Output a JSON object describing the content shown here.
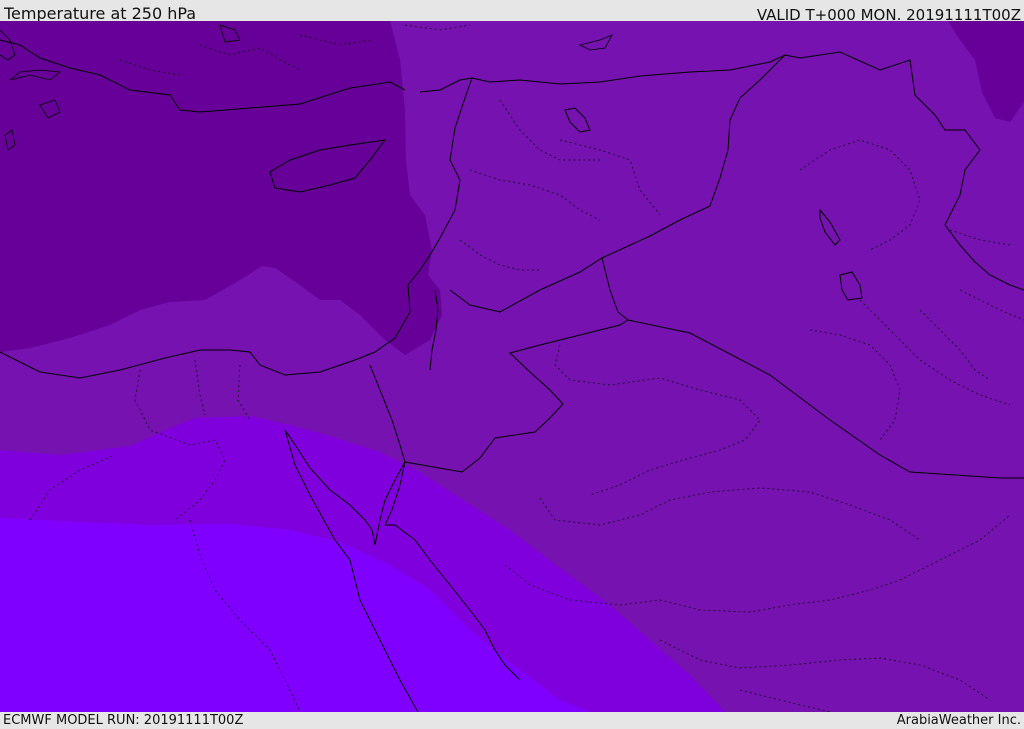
{
  "header": {
    "title": "Temperature at 250 hPa",
    "valid_time": "VALID T+000 MON. 20191111T00Z"
  },
  "footer": {
    "model_run": "ECMWF MODEL RUN: 20191111T00Z",
    "credit": "ArabiaWeather Inc."
  },
  "colors": {
    "band_darkest": "#660099",
    "band_dark": "#7612b0",
    "band_mid": "#8000dd",
    "band_light": "#7f00ff",
    "border_line": "#000000"
  }
}
